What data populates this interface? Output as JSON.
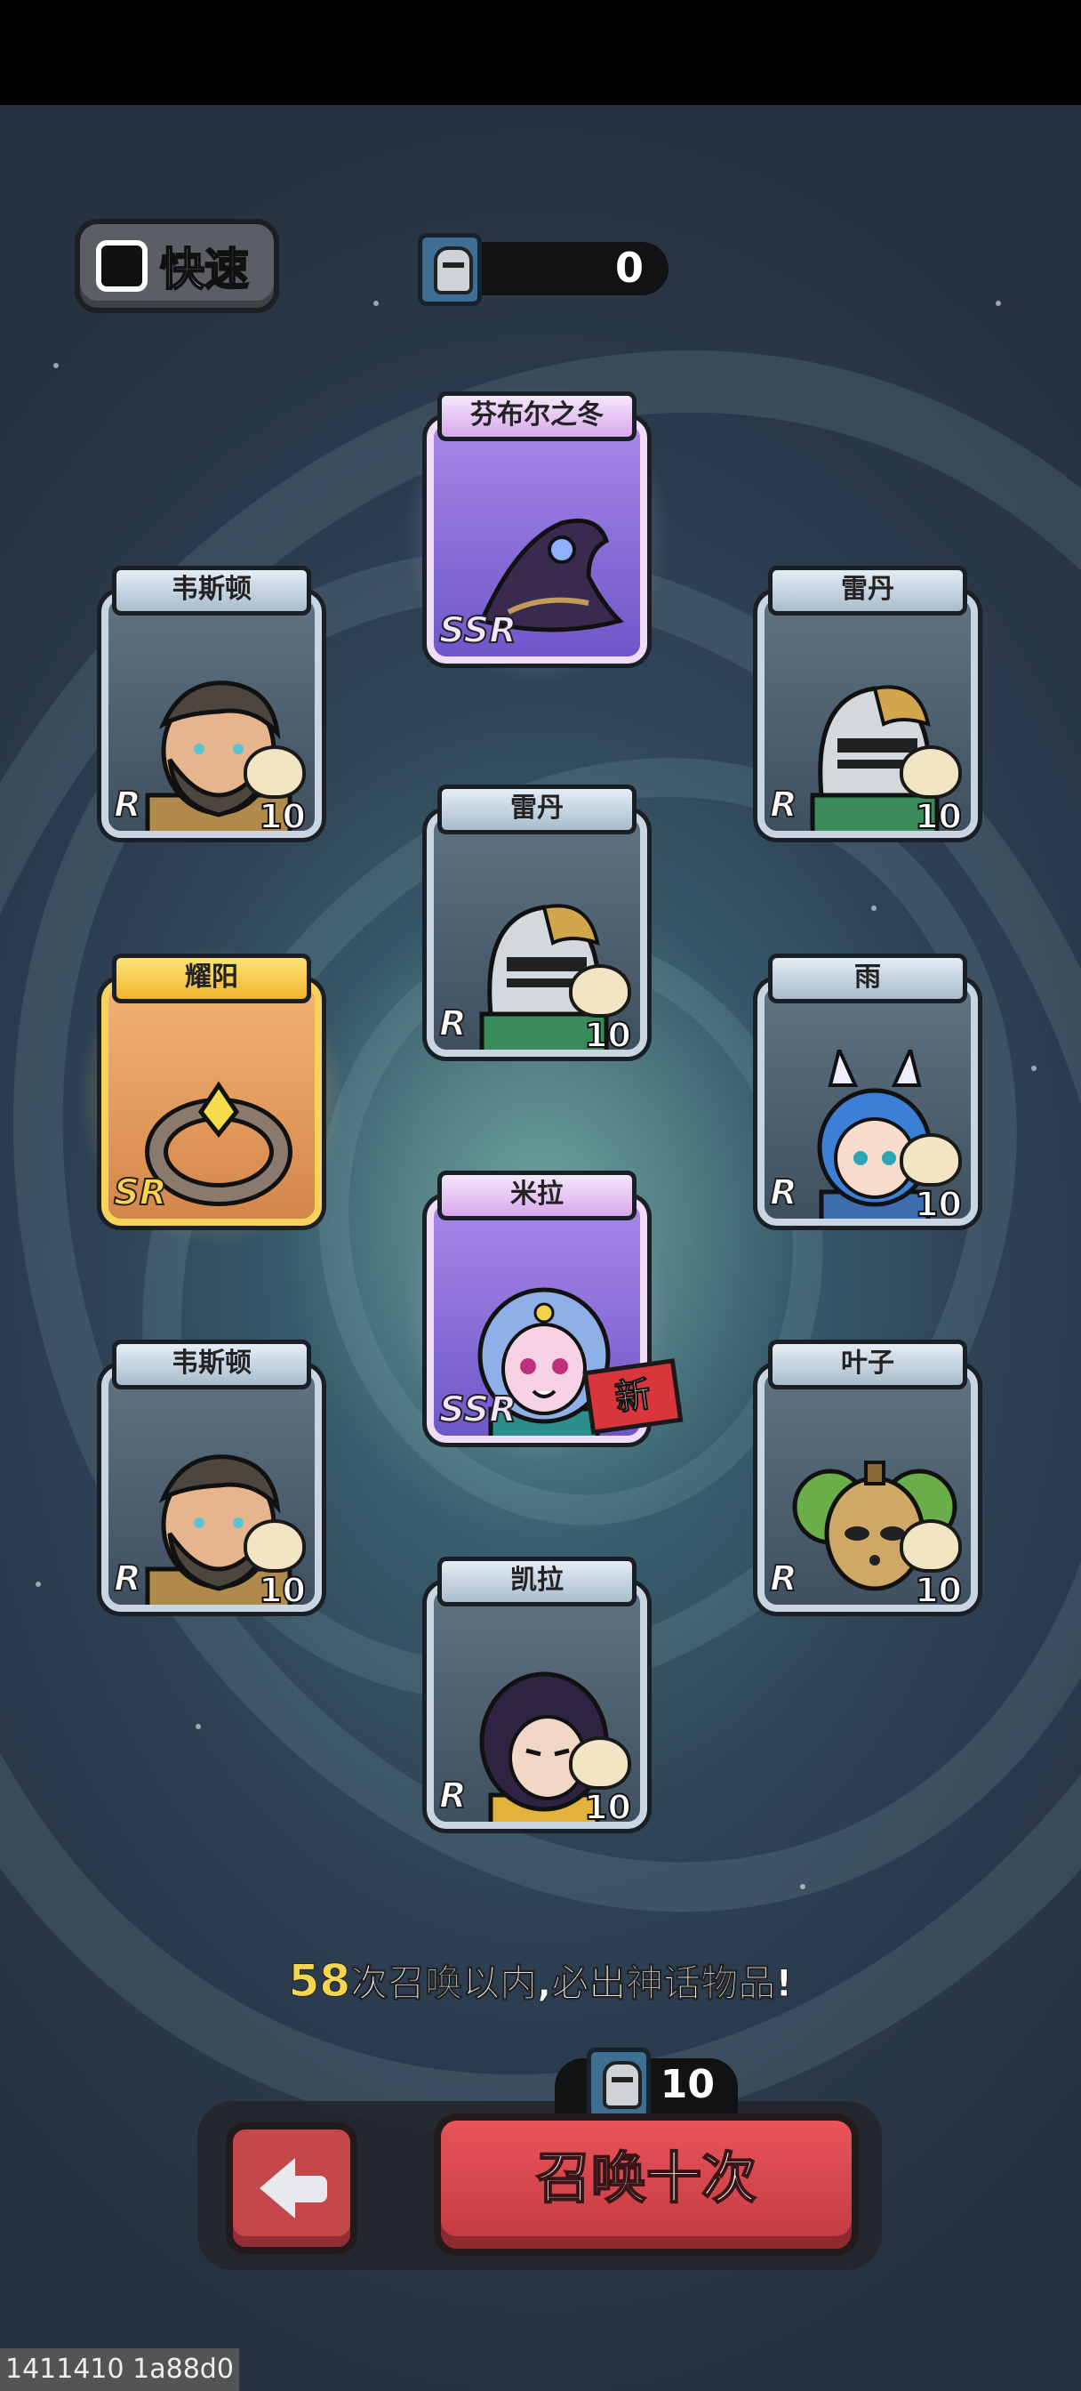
{
  "quick_toggle": {
    "label": "快速",
    "checked": false
  },
  "ticket_counter": {
    "value": "0",
    "icon": "helmet-ticket-icon"
  },
  "cards": [
    {
      "name": "芬布尔之冬",
      "rarity": "SSR",
      "type": "item",
      "art": "dark-hat-icon"
    },
    {
      "name": "韦斯顿",
      "rarity": "R",
      "level": "10",
      "type": "hero",
      "art": "bearded-warrior-portrait"
    },
    {
      "name": "雷丹",
      "rarity": "R",
      "level": "10",
      "type": "hero",
      "art": "knight-helmet-portrait"
    },
    {
      "name": "雷丹",
      "rarity": "R",
      "level": "10",
      "type": "hero",
      "art": "knight-helmet-portrait"
    },
    {
      "name": "耀阳",
      "rarity": "SR",
      "type": "item",
      "art": "ring-icon"
    },
    {
      "name": "雨",
      "rarity": "R",
      "level": "10",
      "type": "hero",
      "art": "bunny-girl-portrait"
    },
    {
      "name": "米拉",
      "rarity": "SSR",
      "type": "hero",
      "art": "elf-girl-portrait",
      "new_tag": "新"
    },
    {
      "name": "韦斯顿",
      "rarity": "R",
      "level": "10",
      "type": "hero",
      "art": "bearded-warrior-portrait"
    },
    {
      "name": "叶子",
      "rarity": "R",
      "level": "10",
      "type": "hero",
      "art": "tree-spirit-portrait"
    },
    {
      "name": "凯拉",
      "rarity": "R",
      "level": "10",
      "type": "hero",
      "art": "dark-haired-girl-portrait"
    }
  ],
  "pity": {
    "count": "58",
    "text": "次召唤以内,必出神话物品!"
  },
  "summon": {
    "button_label": "召唤十次",
    "cost": "10",
    "back_icon": "back-arrow-icon"
  },
  "footer_text": "1411410 1a88d0"
}
